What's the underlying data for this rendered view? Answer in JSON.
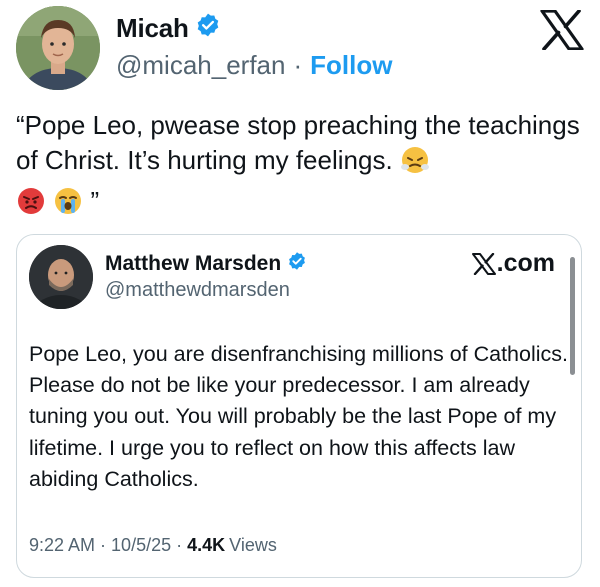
{
  "author": {
    "name": "Micah",
    "handle": "@micah_erfan",
    "separator": "·",
    "follow_label": "Follow",
    "verified": true
  },
  "tweet": {
    "text_before_emoji": "“Pope Leo, pwease stop preaching the teachings of Christ. It’s hurting my feelings.",
    "text_closing_quote": "”",
    "emojis": [
      "face-with-steam-icon",
      "pouting-face-icon",
      "loudly-crying-face-icon"
    ]
  },
  "quote": {
    "name": "Matthew Marsden",
    "handle": "@matthewdmarsden",
    "source_label": ".com",
    "text": "Pope Leo, you are disenfranchising millions of Catholics. Please do not be like your predecessor. I am already tuning you out. You will probably be the last Pope of my lifetime. I urge you to reflect on how this affects law abiding Catholics.",
    "time": "9:22 AM",
    "date": "10/5/25",
    "sep": "·",
    "views_count": "4.4K",
    "views_label": "Views"
  },
  "colors": {
    "link": "#1d9bf0",
    "secondary_text": "#536471",
    "primary_text": "#0f1419",
    "border": "#cfd9de"
  }
}
